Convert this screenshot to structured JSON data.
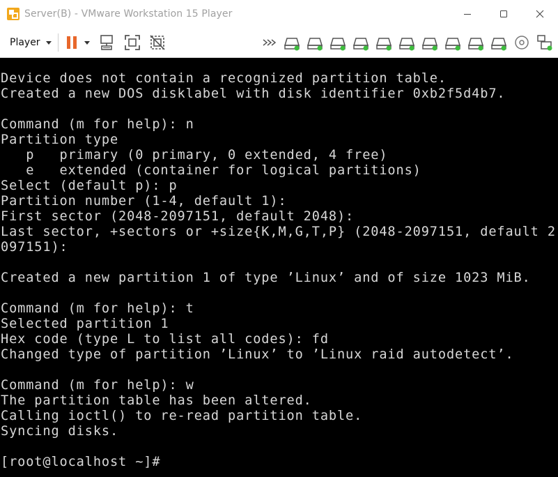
{
  "window": {
    "title": "Server(B) - VMware Workstation 15 Player"
  },
  "toolbar": {
    "player_label": "Player",
    "colors": {
      "pause": "#e8672b",
      "device_green": "#3dbd3d",
      "icon_gray": "#555555"
    },
    "icons": [
      "pause-icon",
      "send-ctrl-alt-del-icon",
      "full-screen-icon",
      "unity-icon",
      "more-devices-icon",
      "hard-disk-icon",
      "cd-dvd-icon",
      "message-log-icon"
    ]
  },
  "console": {
    "lines": [
      "Device does not contain a recognized partition table.",
      "Created a new DOS disklabel with disk identifier 0xb2f5d4b7.",
      "",
      "Command (m for help): n",
      "Partition type",
      "   p   primary (0 primary, 0 extended, 4 free)",
      "   e   extended (container for logical partitions)",
      "Select (default p): p",
      "Partition number (1-4, default 1):",
      "First sector (2048-2097151, default 2048):",
      "Last sector, +sectors or +size{K,M,G,T,P} (2048-2097151, default 2",
      "097151):",
      "",
      "Created a new partition 1 of type ’Linux’ and of size 1023 MiB.",
      "",
      "Command (m for help): t",
      "Selected partition 1",
      "Hex code (type L to list all codes): fd",
      "Changed type of partition ’Linux’ to ’Linux raid autodetect’.",
      "",
      "Command (m for help): w",
      "The partition table has been altered.",
      "Calling ioctl() to re-read partition table.",
      "Syncing disks.",
      "",
      "[root@localhost ~]#"
    ]
  }
}
